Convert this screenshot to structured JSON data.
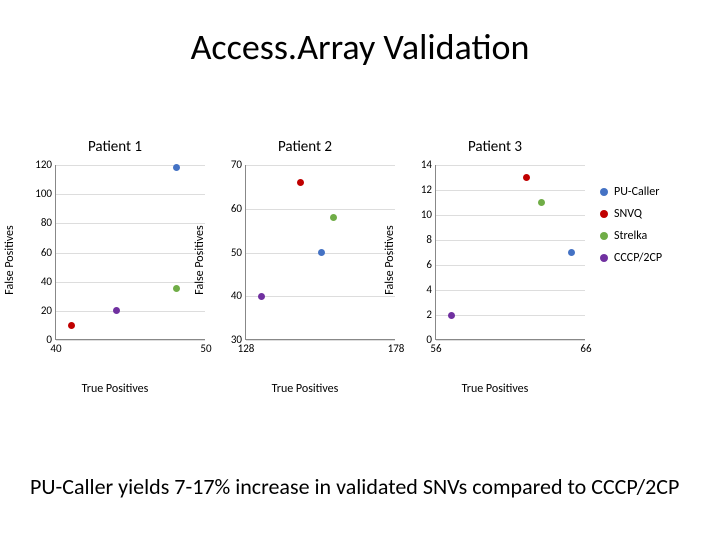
{
  "title": "Access.Array Validation",
  "footer": "PU-Caller yields 7-17% increase in validated SNVs compared to CCCP/2CP",
  "axis_labels": {
    "x": "True Positives",
    "y": "False Positives"
  },
  "series_meta": [
    {
      "name": "PU-Caller",
      "color": "#4472C4"
    },
    {
      "name": "SNVQ",
      "color": "#C00000"
    },
    {
      "name": "Strelka",
      "color": "#70AD47"
    },
    {
      "name": "CCCP/2CP",
      "color": "#7030A0"
    }
  ],
  "chart_data": [
    {
      "type": "scatter",
      "title": "Patient 1",
      "xlabel": "True Positives",
      "ylabel": "False Positives",
      "xlim": [
        40,
        50
      ],
      "ylim": [
        0,
        120
      ],
      "xticks": [
        40,
        50
      ],
      "yticks": [
        0,
        20,
        40,
        60,
        80,
        100,
        120
      ],
      "series": [
        {
          "name": "PU-Caller",
          "x": [
            48
          ],
          "y": [
            118
          ]
        },
        {
          "name": "SNVQ",
          "x": [
            41
          ],
          "y": [
            10
          ]
        },
        {
          "name": "Strelka",
          "x": [
            48
          ],
          "y": [
            35
          ]
        },
        {
          "name": "CCCP/2CP",
          "x": [
            44
          ],
          "y": [
            20
          ]
        }
      ]
    },
    {
      "type": "scatter",
      "title": "Patient 2",
      "xlabel": "True Positives",
      "ylabel": "False Positives",
      "xlim": [
        128,
        178
      ],
      "ylim": [
        30,
        70
      ],
      "xticks": [
        128,
        178
      ],
      "yticks": [
        30,
        40,
        50,
        60,
        70
      ],
      "series": [
        {
          "name": "PU-Caller",
          "x": [
            153
          ],
          "y": [
            50
          ]
        },
        {
          "name": "SNVQ",
          "x": [
            146
          ],
          "y": [
            66
          ]
        },
        {
          "name": "Strelka",
          "x": [
            157
          ],
          "y": [
            58
          ]
        },
        {
          "name": "CCCP/2CP",
          "x": [
            133
          ],
          "y": [
            40
          ]
        }
      ]
    },
    {
      "type": "scatter",
      "title": "Patient 3",
      "xlabel": "True Positives",
      "ylabel": "False Positives",
      "xlim": [
        56,
        66
      ],
      "ylim": [
        0,
        14
      ],
      "xticks": [
        56,
        66
      ],
      "yticks": [
        0,
        2,
        4,
        6,
        8,
        10,
        12,
        14
      ],
      "series": [
        {
          "name": "PU-Caller",
          "x": [
            65
          ],
          "y": [
            7
          ]
        },
        {
          "name": "SNVQ",
          "x": [
            62
          ],
          "y": [
            13
          ]
        },
        {
          "name": "Strelka",
          "x": [
            63
          ],
          "y": [
            11
          ]
        },
        {
          "name": "CCCP/2CP",
          "x": [
            57
          ],
          "y": [
            2
          ]
        }
      ]
    }
  ]
}
